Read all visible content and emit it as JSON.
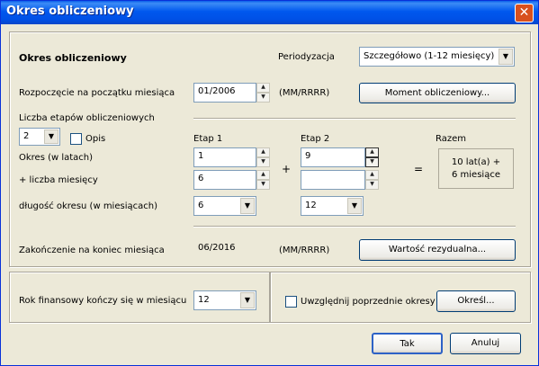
{
  "window": {
    "title": "Okres obliczeniowy",
    "close_glyph": "✕"
  },
  "section_title": "Okres obliczeniowy",
  "periodization": {
    "label": "Periodyzacja",
    "value": "Szczegółowo (1-12 miesięcy)"
  },
  "start": {
    "label": "Rozpoczęcie na początku miesiąca",
    "value": "01/2006",
    "format": "(MM/RRRR)"
  },
  "moment_button": "Moment obliczeniowy...",
  "stages": {
    "count_label": "Liczba etapów obliczeniowych",
    "count_value": "2",
    "opis_label": "Opis",
    "stage1_header": "Etap 1",
    "stage2_header": "Etap 2",
    "total_header": "Razem",
    "period_years_label": "Okres (w latach)",
    "months_count_label": "+ liczba miesięcy",
    "period_length_label": "długość okresu (w miesiącach)",
    "stage1_years": "1",
    "stage1_months": "6",
    "stage1_length": "6",
    "stage2_years": "9",
    "stage2_months": "",
    "stage2_length": "12",
    "plus_sign": "+",
    "equals_sign": "=",
    "total_line1": "10 lat(a) +",
    "total_line2": "6 miesiące"
  },
  "end": {
    "label": "Zakończenie na koniec miesiąca",
    "value": "06/2016",
    "format": "(MM/RRRR)"
  },
  "residual_button": "Wartość rezydualna...",
  "fiscal": {
    "label": "Rok finansowy kończy się w miesiącu",
    "value": "12"
  },
  "previous_periods": {
    "label": "Uwzględnij poprzednie okresy",
    "button": "Określ..."
  },
  "ok_button": "Tak",
  "cancel_button": "Anuluj"
}
